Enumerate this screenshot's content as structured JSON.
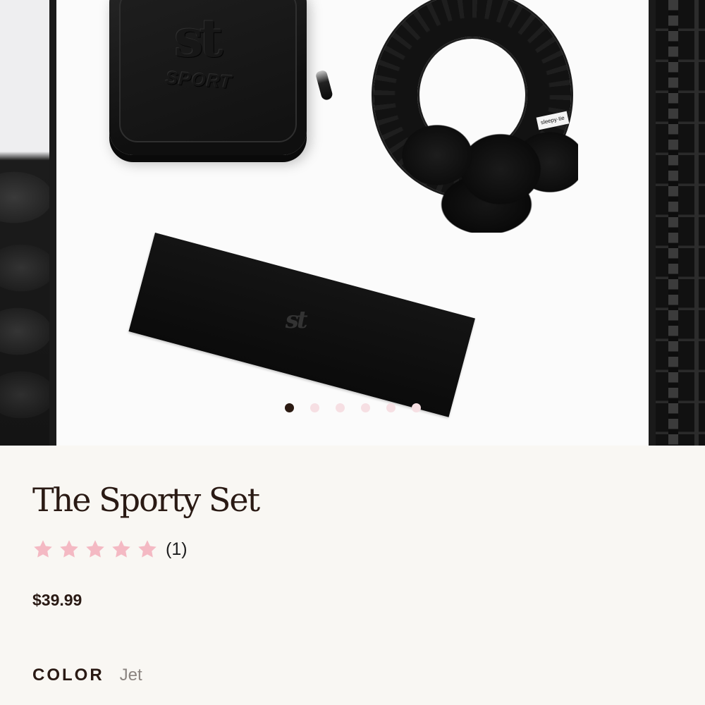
{
  "gallery": {
    "slide_count": 6,
    "active_index": 0,
    "main_image_alt": "",
    "case_emboss_logo": "st",
    "case_emboss_word": "SPORT",
    "scrunchie_tag": "sleepy·tie",
    "headband_logo": "st"
  },
  "product": {
    "title": "The Sporty Set",
    "rating": {
      "stars": 5,
      "max": 5,
      "count_label": "(1)"
    },
    "price": "$39.99",
    "option": {
      "label": "COLOR",
      "value": "Jet"
    }
  },
  "colors": {
    "background": "#f9f7f3",
    "title_text": "#2a1a14",
    "star_fill": "#f4b9c3",
    "dot_active": "#2b1a12",
    "dot_inactive": "#f6dfe3",
    "option_value": "#8b8480"
  },
  "icons": {
    "rating_star": "star-icon"
  }
}
